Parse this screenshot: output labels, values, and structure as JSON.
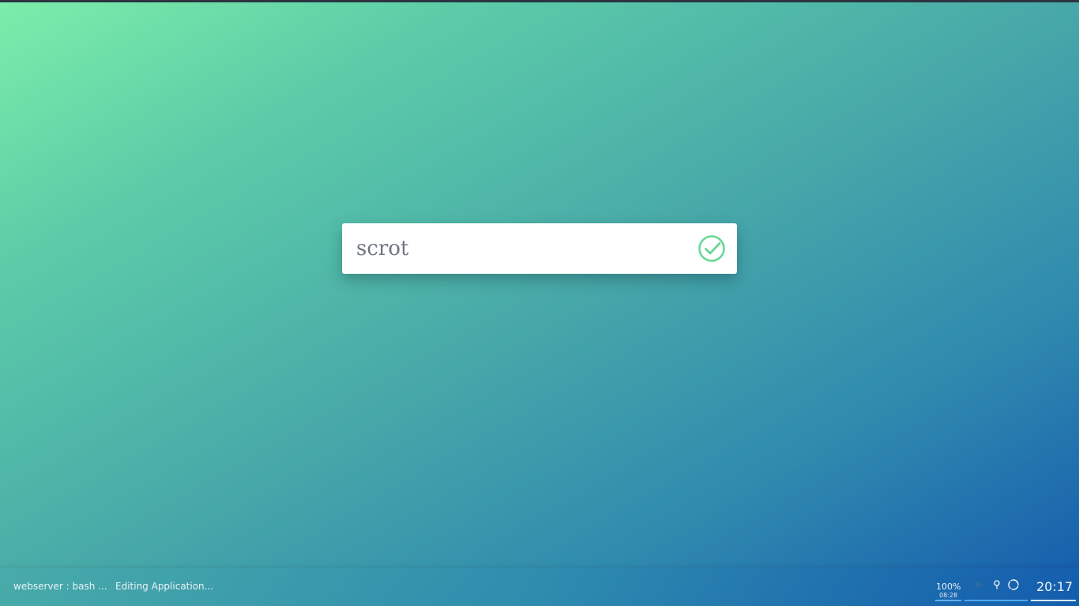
{
  "launcher": {
    "query": "scrot",
    "confirm_icon": "check-circle-icon",
    "accent_color": "#68d895"
  },
  "taskbar": {
    "tasks": [
      {
        "label": "webserver : bash ..."
      },
      {
        "label": "Editing Application..."
      }
    ],
    "battery": {
      "percent": "100%",
      "time_remaining": "08:28",
      "icon": "battery-indicator"
    },
    "tray": {
      "icons": [
        "play-arrow-icon",
        "location-pin-icon",
        "sync-spinner-icon"
      ]
    },
    "clock": "20:17"
  },
  "colors": {
    "gradient_start": "#7dedaa",
    "gradient_end": "#1459ad",
    "panel_accent": "#4ea8f0"
  }
}
